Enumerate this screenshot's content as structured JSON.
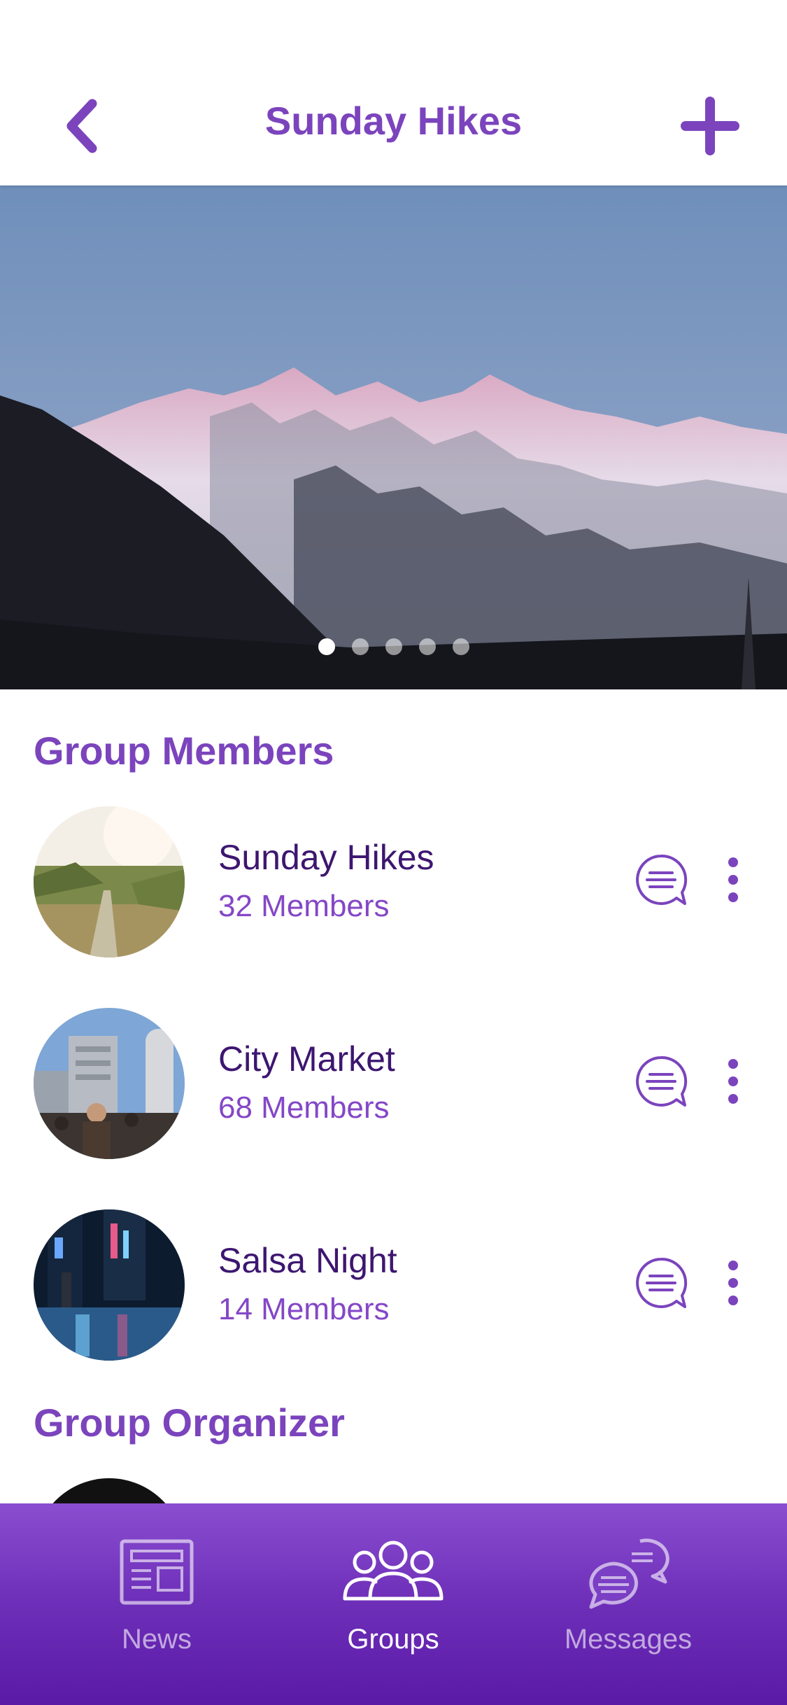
{
  "header": {
    "title": "Sunday Hikes",
    "back_icon": "chevron-left-icon",
    "add_icon": "plus-icon"
  },
  "carousel": {
    "page_count": 5,
    "active_index": 0
  },
  "members_section": {
    "title": "Group Members",
    "items": [
      {
        "name": "Sunday Hikes",
        "members": "32 Members"
      },
      {
        "name": "City Market",
        "members": "68 Members"
      },
      {
        "name": "Salsa Night",
        "members": "14 Members"
      }
    ]
  },
  "organizer_section": {
    "title": "Group Organizer"
  },
  "tabbar": {
    "tabs": [
      {
        "label": "News",
        "icon": "newspaper-icon",
        "active": false
      },
      {
        "label": "Groups",
        "icon": "people-icon",
        "active": true
      },
      {
        "label": "Messages",
        "icon": "chat-bubbles-icon",
        "active": false
      }
    ]
  },
  "colors": {
    "accent": "#7b44bd",
    "name_text": "#3d1670",
    "tabbar_top": "#8a4ed0",
    "tabbar_bottom": "#5a1aa6"
  }
}
